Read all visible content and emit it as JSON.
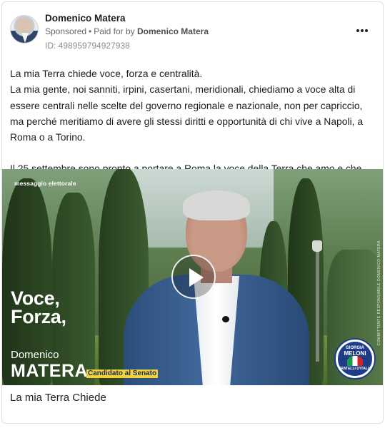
{
  "ad": {
    "page_name": "Domenico Matera",
    "sponsored_label": "Sponsored",
    "paid_for_prefix": "Paid for by",
    "paid_for_name": "Domenico Matera",
    "ad_id": "ID: 498959794927938",
    "body_paragraphs": [
      "La mia Terra chiede voce, forza e centralità.",
      "La mia gente, noi sanniti, irpini, casertani, meridionali, chiediamo a voce alta di essere centrali nelle scelte del governo regionale e nazionale, non per capriccio, ma perché meritiamo di avere gli stessi diritti e opportunità di chi vive a Napoli, a Roma o a Torino.",
      "Il 25 settembre sono pronto a portare a Roma la voce della Terra che amo e che…"
    ],
    "video": {
      "corner_label": "messaggio elettorale",
      "side_note": "COMMITTENTE RESPONSABILE DOMENICO MATERA",
      "slogan_line1": "Voce,",
      "slogan_line2": "Forza,",
      "candidate_first_name": "Domenico",
      "candidate_last_name": "MATERA",
      "candidate_role": "Candidato al Senato",
      "party_logo_top": "GIORGIA",
      "party_logo_mid": "MELONI",
      "party_logo_bottom": "FRATELLI D'ITALIA"
    },
    "caption": "La mia Terra Chiede"
  },
  "icons": {
    "more_options": "more-options-icon",
    "play": "play-icon",
    "avatar": "profile-avatar"
  },
  "colors": {
    "role_highlight": "#f2d33a",
    "party_blue": "#1f3c88"
  }
}
